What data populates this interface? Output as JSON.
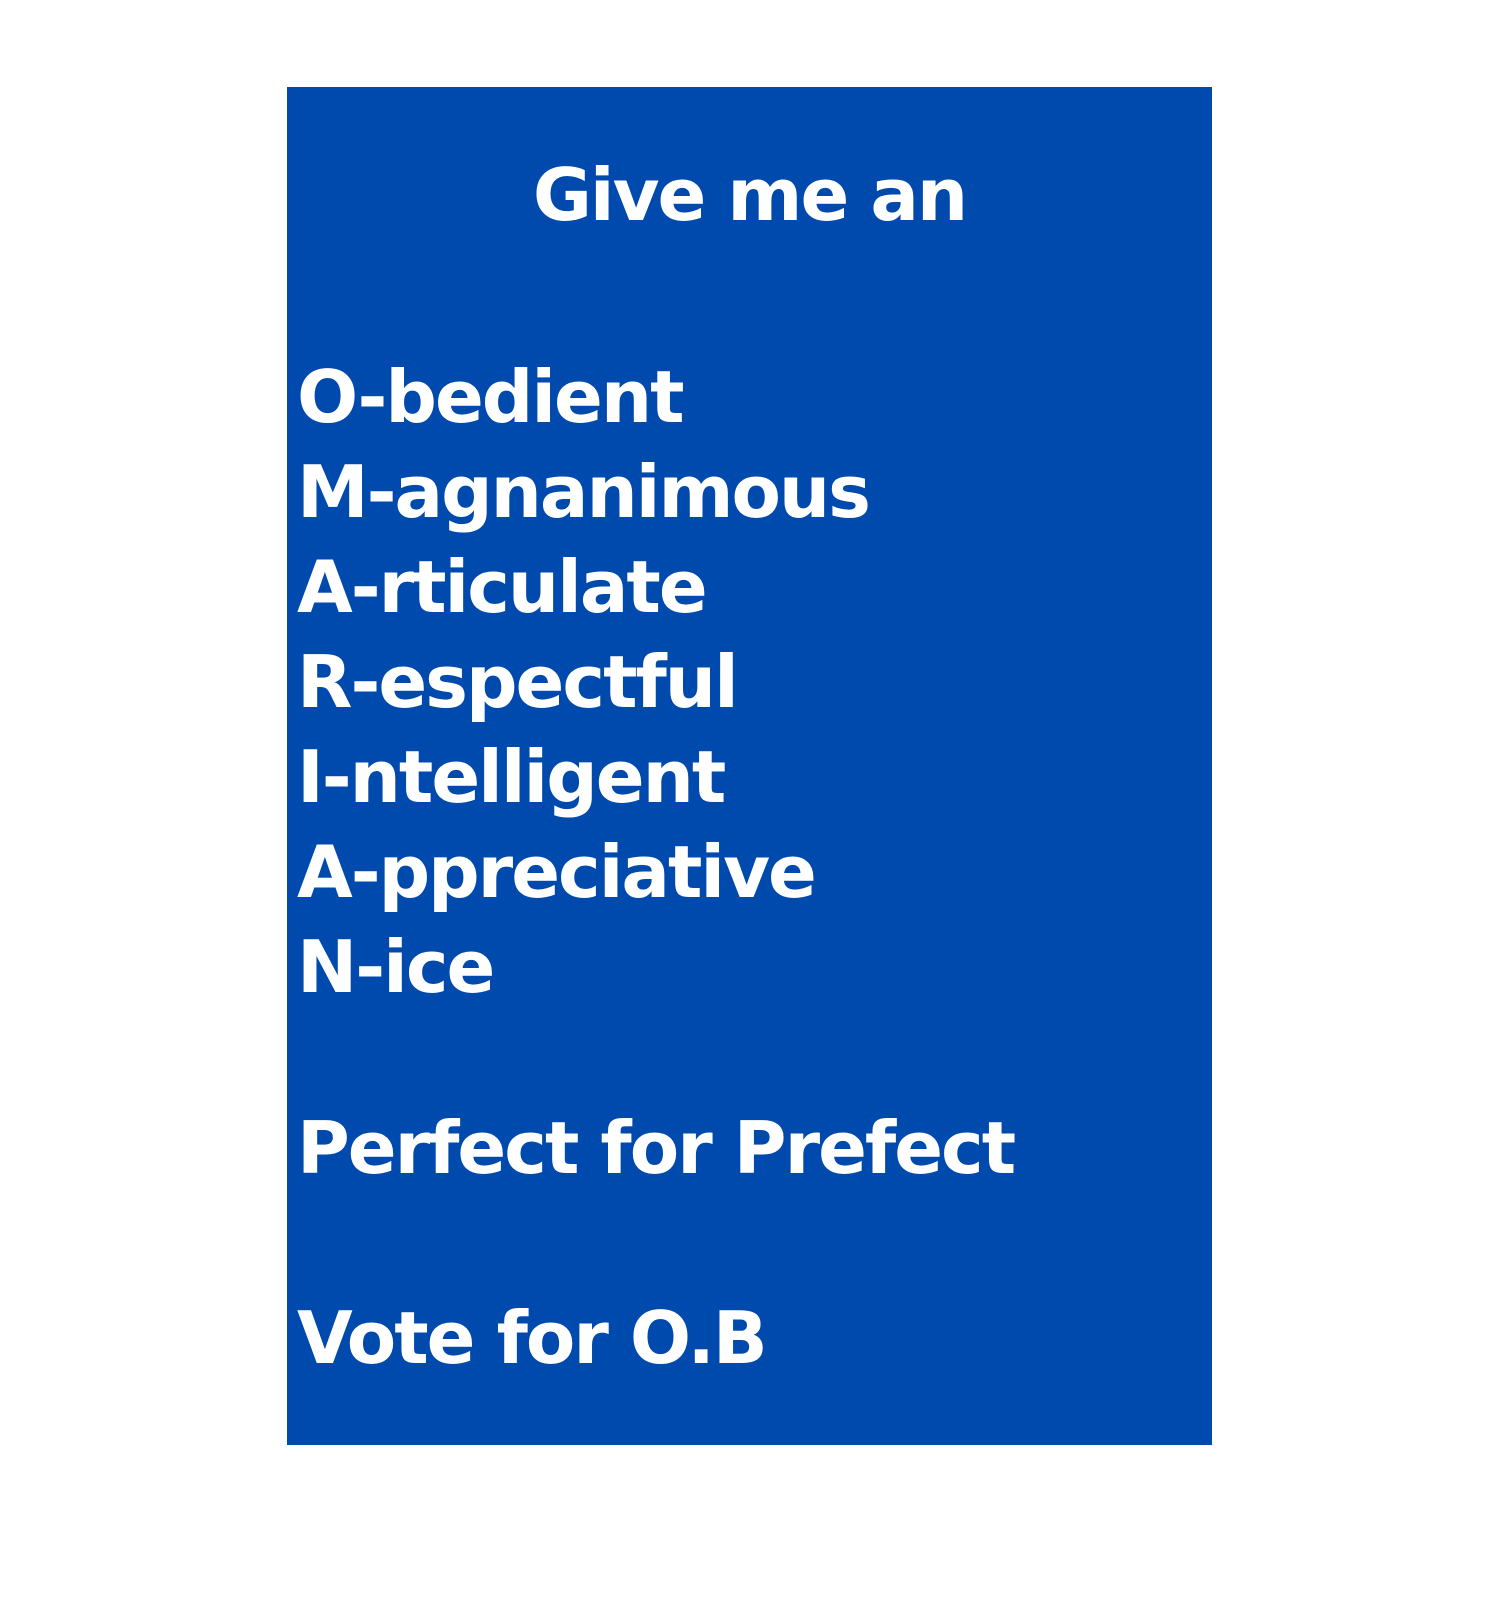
{
  "poster": {
    "background_color": "#004aad",
    "text_color": "#ffffff",
    "heading": "Give me an",
    "acrostic": [
      "O-bedient",
      "M-agnanimous",
      "A-rticulate",
      "R-espectful",
      "I-ntelligent",
      "A-ppreciative",
      "N-ice"
    ],
    "tagline": "Perfect for Prefect",
    "call_to_action": "Vote for O.B"
  }
}
